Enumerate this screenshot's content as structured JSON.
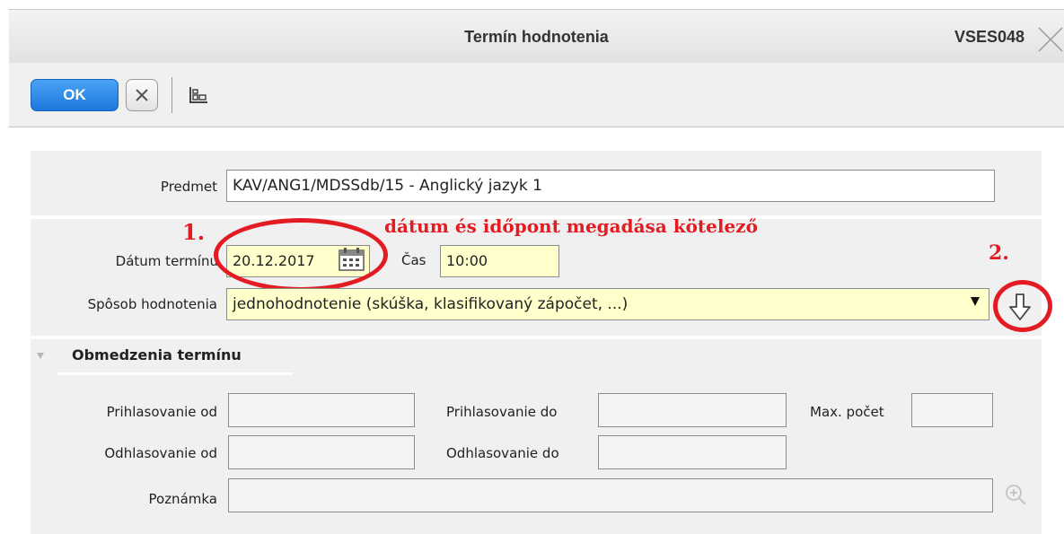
{
  "window": {
    "title": "Termín hodnotenia",
    "code": "VSES048"
  },
  "toolbar": {
    "ok_label": "OK"
  },
  "form": {
    "predmet": {
      "label": "Predmet",
      "value": "KAV/ANG1/MDSSdb/15 - Anglický jazyk 1"
    },
    "datum": {
      "label": "Dátum termínu",
      "value": "20.12.2017"
    },
    "cas": {
      "label": "Čas",
      "value": "10:00"
    },
    "sposob": {
      "label": "Spôsob hodnotenia",
      "value": "jednohodnotenie (skúška, klasifikovaný zápočet, ...)"
    }
  },
  "section": {
    "title": "Obmedzenia termínu",
    "prihlasovanie_od": "Prihlasovanie od",
    "prihlasovanie_do": "Prihlasovanie do",
    "max_pocet": "Max. počet",
    "odhlasovanie_od": "Odhlasovanie od",
    "odhlasovanie_do": "Odhlasovanie do",
    "poznamka": "Poznámka"
  },
  "annotations": {
    "step1": "1.",
    "step2": "2.",
    "note": "dátum és időpont megadása kötelező",
    "color": "#e31b23"
  },
  "colors": {
    "ok_button": "#1c78dc",
    "required_field": "#ffffcc",
    "panel": "#f0f0f0"
  }
}
